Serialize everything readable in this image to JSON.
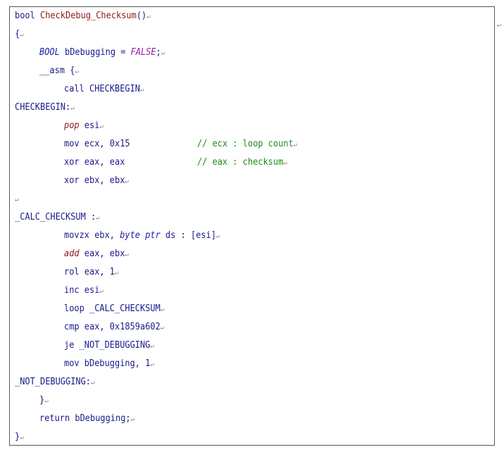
{
  "mark": "↵",
  "lines": {
    "l1_kw": "bool",
    "l1_fn": "CheckDebug_Checksum",
    "l1_rest": "()",
    "l2": "{",
    "l3_ty": "BOOL",
    "l3_mid": " bDebugging = ",
    "l3_val": "FALSE",
    "l3_end": ";",
    "l4": "__asm {",
    "l5": "call CHECKBEGIN",
    "l6": "CHECKBEGIN:",
    "l7_kw": "pop",
    "l7_rest": " esi",
    "l8_code": "mov ecx, 0x15",
    "l8_cmt": "// ecx : loop count",
    "l9_code": "xor eax, eax",
    "l9_cmt": "// eax : checksum",
    "l10": "xor ebx, ebx",
    "l11": "",
    "l12": "_CALC_CHECKSUM :",
    "l13_a": "movzx ebx, ",
    "l13_ty": "byte ptr",
    "l13_b": " ds : [esi]",
    "l14_kw": "add",
    "l14_rest": " eax, ebx",
    "l15": "rol eax, 1",
    "l16": "inc esi",
    "l17": "loop _CALC_CHECKSUM",
    "l18": "cmp eax, 0x1859a602",
    "l19": "je _NOT_DEBUGGING",
    "l20": "mov bDebugging, 1",
    "l21": "_NOT_DEBUGGING:",
    "l22": "}",
    "l23": "return bDebugging;",
    "l24": "}"
  }
}
